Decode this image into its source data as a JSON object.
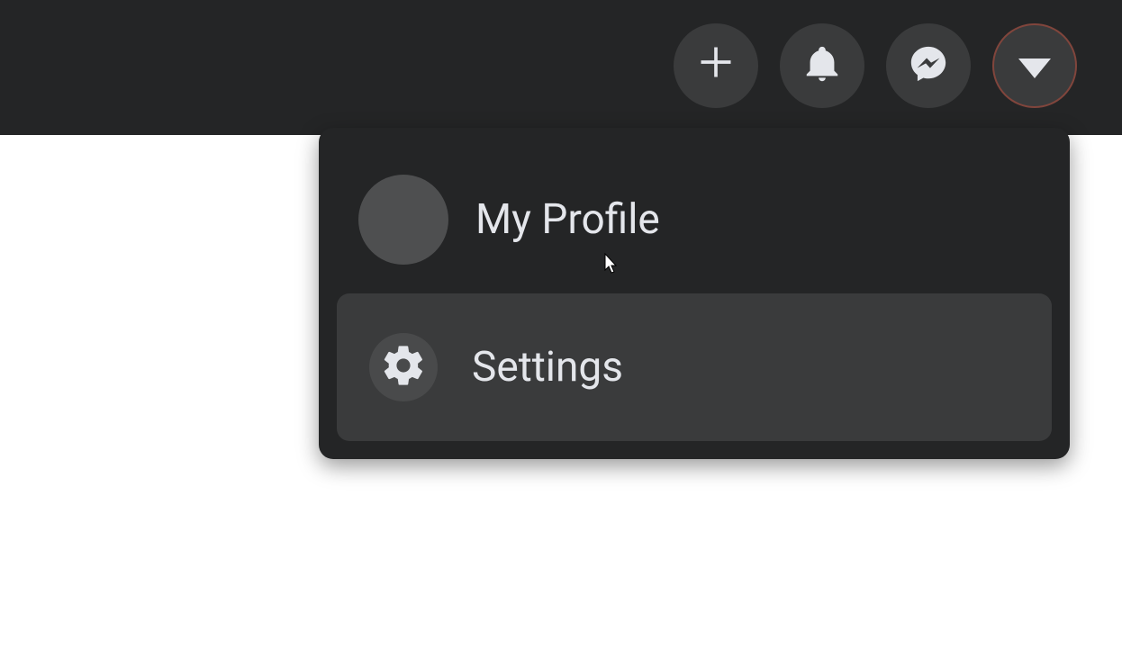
{
  "nav": {
    "create": "plus",
    "notifications": "bell",
    "messenger": "messenger",
    "account": "caret-down"
  },
  "dropdown": {
    "profile": {
      "label": "My Profile"
    },
    "settings": {
      "label": "Settings"
    }
  }
}
